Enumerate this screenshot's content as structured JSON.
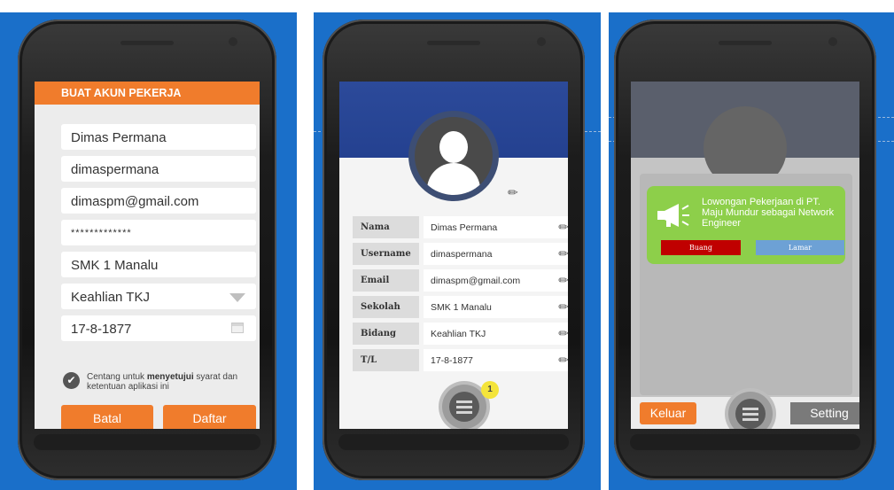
{
  "screen1": {
    "header": "BUAT AKUN PEKERJA",
    "fields": {
      "name": "Dimas Permana",
      "username": "dimaspermana",
      "email": "dimaspm@gmail.com",
      "password": "*************",
      "school": "SMK 1 Manalu",
      "field_of_study": "Keahlian TKJ",
      "birth_date": "17-8-1877"
    },
    "terms_prefix": "Centang untuk ",
    "terms_bold": "menyetujui",
    "terms_suffix": " syarat dan ketentuan aplikasi ini",
    "cancel_label": "Batal",
    "register_label": "Daftar",
    "accent": "#f07c2c"
  },
  "screen2": {
    "profile_rows": [
      {
        "label": "Nama",
        "value": "Dimas Permana"
      },
      {
        "label": "Username",
        "value": "dimaspermana"
      },
      {
        "label": "Email",
        "value": "dimaspm@gmail.com"
      },
      {
        "label": "Sekolah",
        "value": "SMK 1 Manalu"
      },
      {
        "label": "Bidang",
        "value": "Keahlian TKJ"
      },
      {
        "label": "T/L",
        "value": "17-8-1877"
      }
    ],
    "notification_count": "1",
    "banner_color": "#2c4a9a"
  },
  "screen3": {
    "notification_text": "Lowongan Pekerjaan di PT. Maju Mundur sebagai Network Engineer",
    "dismiss_label": "Buang",
    "apply_label": "Lamar",
    "logout_label": "Keluar",
    "settings_label": "Setting",
    "notification_color": "#8dcf4a"
  },
  "icons": [
    "check-icon",
    "dropdown-arrow-icon",
    "calendar-icon",
    "edit-pencil-icon",
    "menu-icon",
    "megaphone-icon",
    "user-avatar-icon"
  ]
}
